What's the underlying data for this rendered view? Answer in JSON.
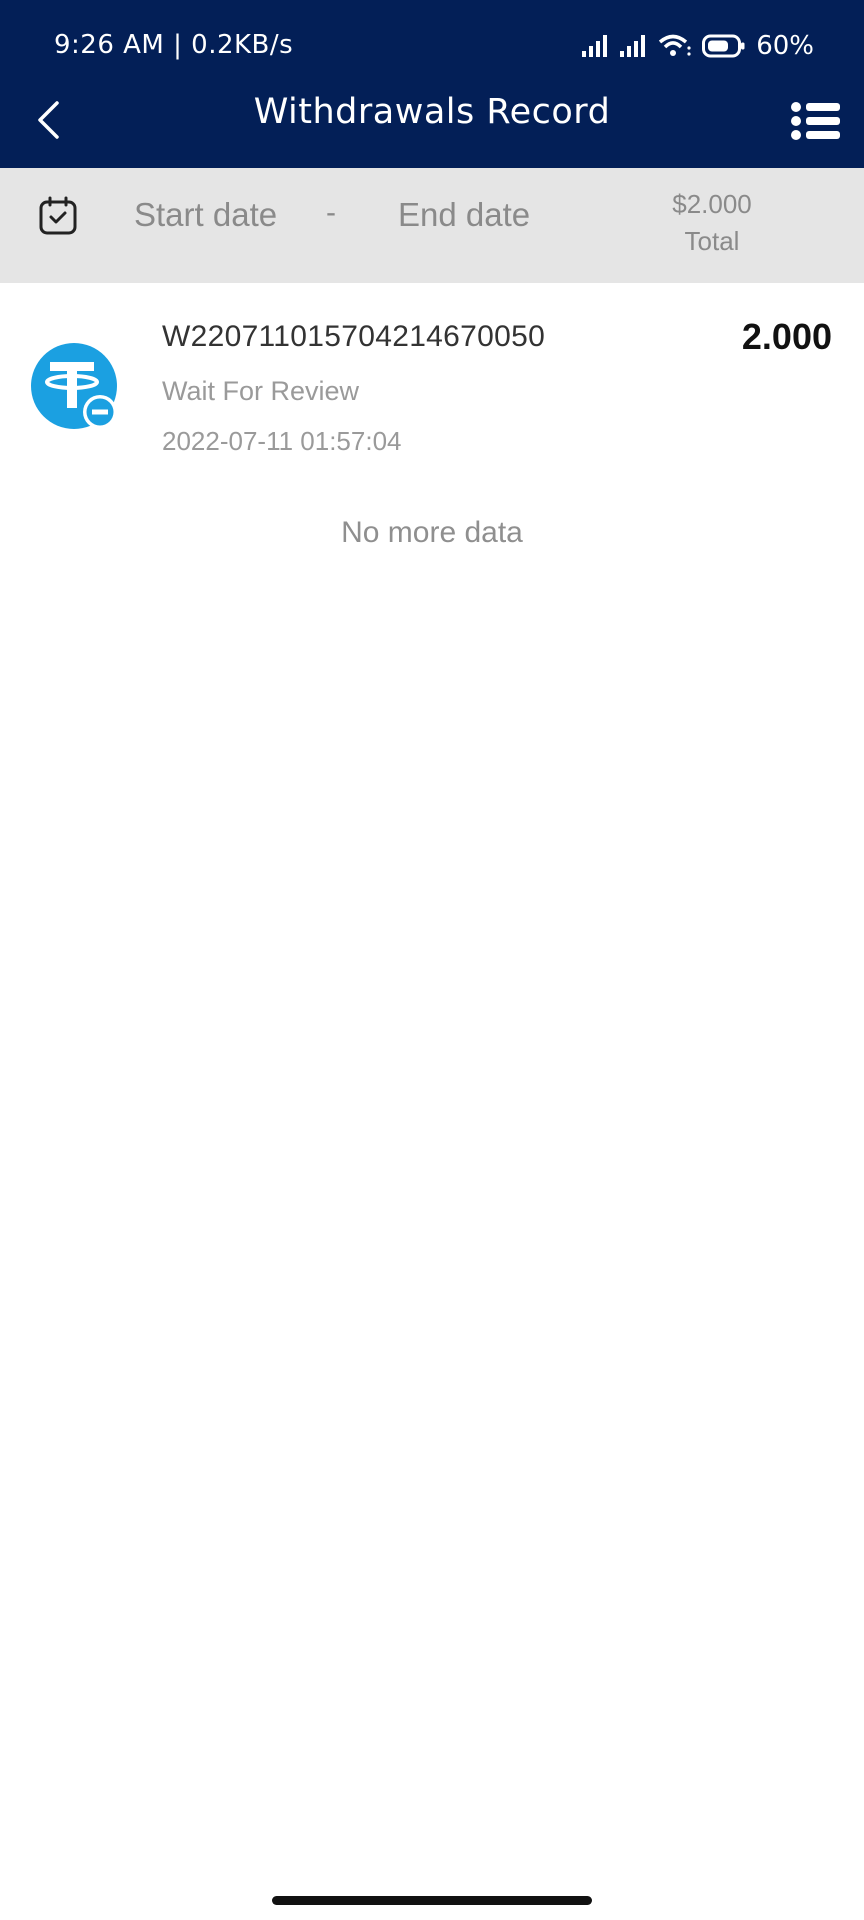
{
  "status_bar": {
    "time_speed": "9:26 AM | 0.2KB/s",
    "battery_percent": "60%",
    "icons": [
      "signal-icon",
      "signal-icon",
      "wifi-icon",
      "battery-icon"
    ]
  },
  "header": {
    "title": "Withdrawals Record",
    "back_icon": "chevron-left-icon",
    "menu_icon": "list-menu-icon",
    "background": "#031f57"
  },
  "filter": {
    "calendar_icon": "calendar-icon",
    "start_date_placeholder": "Start date",
    "separator": "-",
    "end_date_placeholder": "End date",
    "total_amount": "$2.000",
    "total_label": "Total"
  },
  "records": [
    {
      "icon": "tether-coin-icon",
      "order_id": "W220711015704214670050",
      "status": "Wait For Review",
      "timestamp": "2022-07-11 01:57:04",
      "amount": "2.000",
      "icon_color": "#1ba0e1"
    }
  ],
  "list_end_text": "No more data"
}
